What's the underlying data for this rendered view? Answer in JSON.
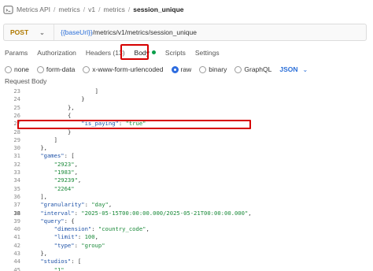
{
  "breadcrumb": {
    "items": [
      "Metrics API",
      "metrics",
      "v1",
      "metrics",
      "session_unique"
    ],
    "current": "session_unique",
    "separator": "/"
  },
  "request": {
    "method": "POST",
    "url_variable": "{{baseUrl}}",
    "url_path": "/metrics/v1/metrics/session_unique"
  },
  "tabs": {
    "params": "Params",
    "authorization": "Authorization",
    "headers": "Headers (13)",
    "body": "Body",
    "scripts": "Scripts",
    "settings": "Settings"
  },
  "body_types": {
    "none": "none",
    "form_data": "form-data",
    "urlencoded": "x-www-form-urlencoded",
    "raw": "raw",
    "binary": "binary",
    "graphql": "GraphQL",
    "format": "JSON",
    "selected": "raw"
  },
  "request_body_label": "Request Body",
  "editor": {
    "current_line": 38,
    "lines": [
      {
        "n": "23",
        "text": "                    ]"
      },
      {
        "n": "24",
        "text": "                }"
      },
      {
        "n": "25",
        "text": "            },"
      },
      {
        "n": "26",
        "text": "            {"
      },
      {
        "n": "27",
        "text": "                \"is_paying\": \"true\""
      },
      {
        "n": "28",
        "text": "            }"
      },
      {
        "n": "29",
        "text": "        ]"
      },
      {
        "n": "30",
        "text": "    },"
      },
      {
        "n": "31",
        "text": "    \"games\": ["
      },
      {
        "n": "32",
        "text": "        \"2923\","
      },
      {
        "n": "33",
        "text": "        \"1983\","
      },
      {
        "n": "34",
        "text": "        \"29239\","
      },
      {
        "n": "35",
        "text": "        \"2264\""
      },
      {
        "n": "36",
        "text": "    ],"
      },
      {
        "n": "37",
        "text": "    \"granularity\": \"day\","
      },
      {
        "n": "38",
        "text": "    \"interval\": \"2025-05-15T00:00:00.000/2025-05-21T00:00:00.000\","
      },
      {
        "n": "39",
        "text": "    \"query\": {"
      },
      {
        "n": "40",
        "text": "        \"dimension\": \"country_code\","
      },
      {
        "n": "41",
        "text": "        \"limit\": 100,"
      },
      {
        "n": "42",
        "text": "        \"type\": \"group\""
      },
      {
        "n": "43",
        "text": "    },"
      },
      {
        "n": "44",
        "text": "    \"studios\": ["
      },
      {
        "n": "45",
        "text": "        \"1\","
      }
    ]
  },
  "colors": {
    "method": "#b07a00",
    "url_variable": "#2b6fd8",
    "json_key": "#1f53a8",
    "json_value": "#1b8a3a",
    "highlight": "#d60000",
    "selected_radio": "#2d6cdf",
    "body_dot": "#0a9e4a"
  }
}
